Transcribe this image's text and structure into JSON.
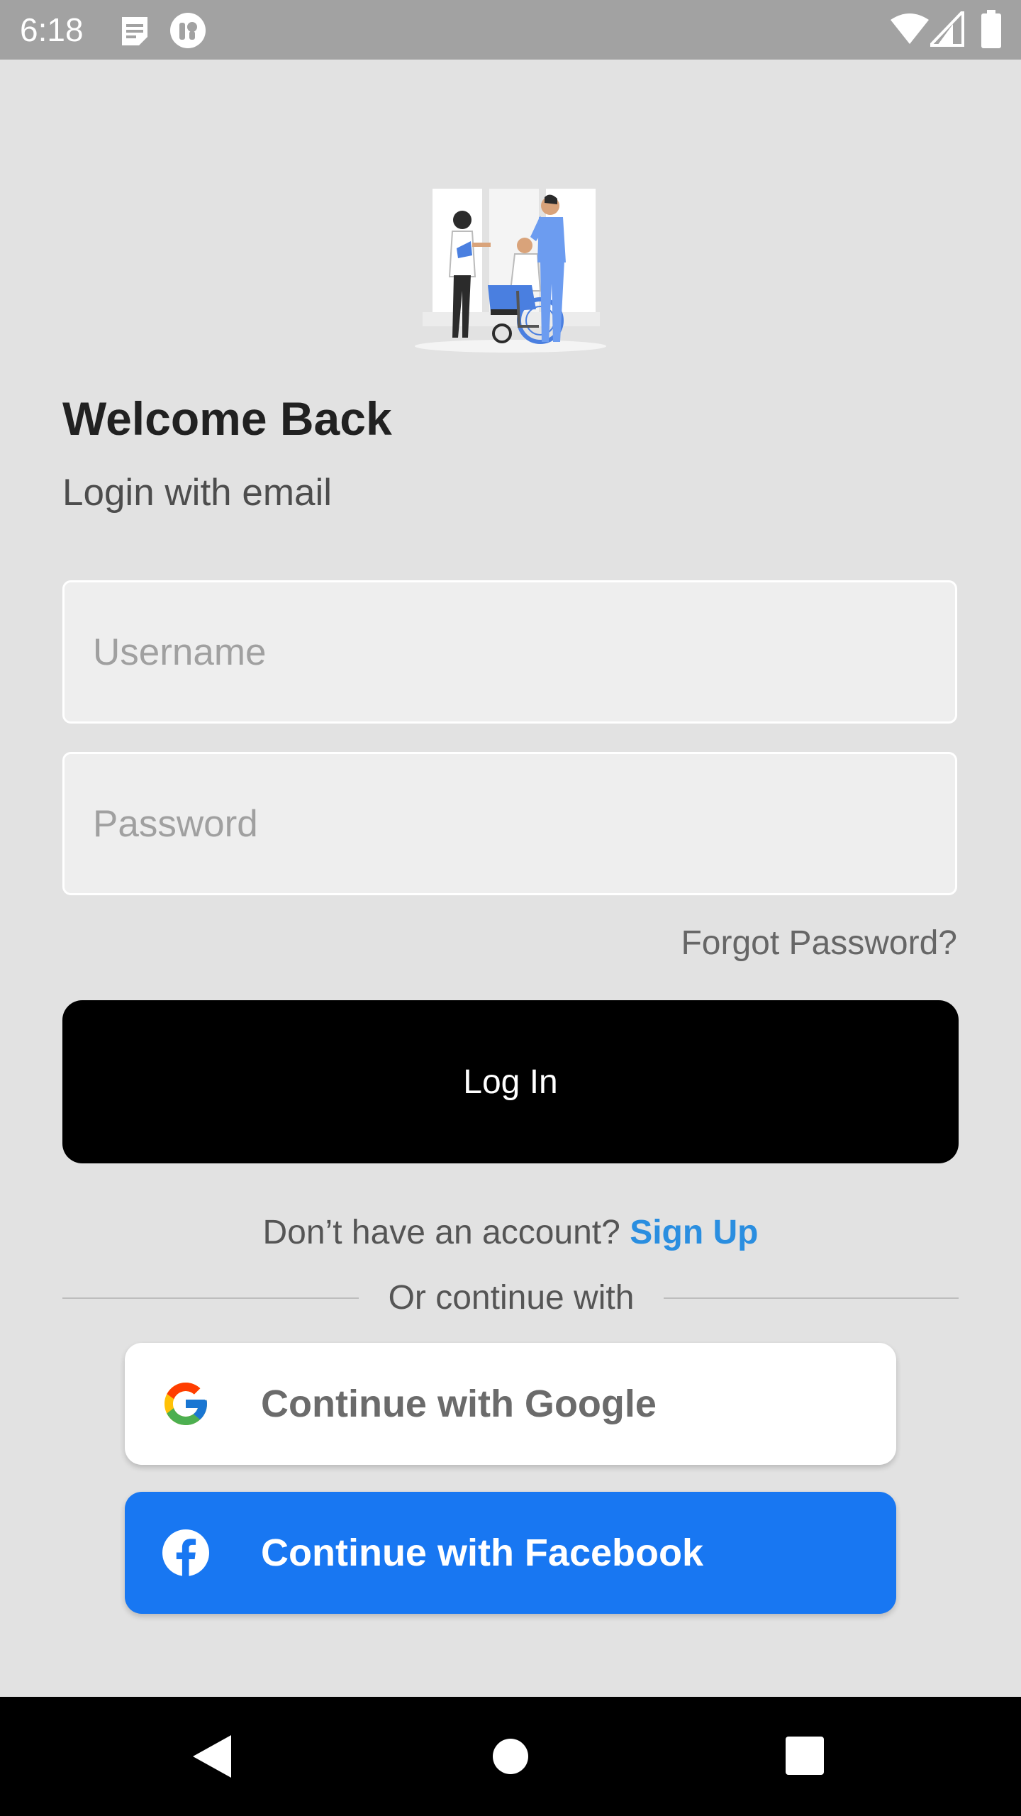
{
  "status_bar": {
    "time": "6:18",
    "icons": [
      "notes-icon",
      "accessibility-icon",
      "wifi-icon",
      "signal-icon",
      "battery-icon"
    ]
  },
  "login": {
    "title": "Welcome Back",
    "subtitle": "Login with email",
    "username_placeholder": "Username",
    "password_placeholder": "Password",
    "forgot_password": "Forgot Password?",
    "login_button": "Log In",
    "signup_prompt": "Don’t have an account?",
    "signup_link": "Sign Up",
    "divider_text": "Or continue with"
  },
  "social": {
    "google_label": "Continue with Google",
    "facebook_label": "Continue with Facebook"
  },
  "colors": {
    "background": "#e2e2e2",
    "status_bar": "#a2a2a2",
    "login_button": "#000000",
    "link": "#2a8ee0",
    "facebook": "#1877f2",
    "illustration_accent": "#4a7fe0"
  },
  "nav_bar": {
    "icons": [
      "back-icon",
      "home-icon",
      "recents-icon"
    ]
  }
}
